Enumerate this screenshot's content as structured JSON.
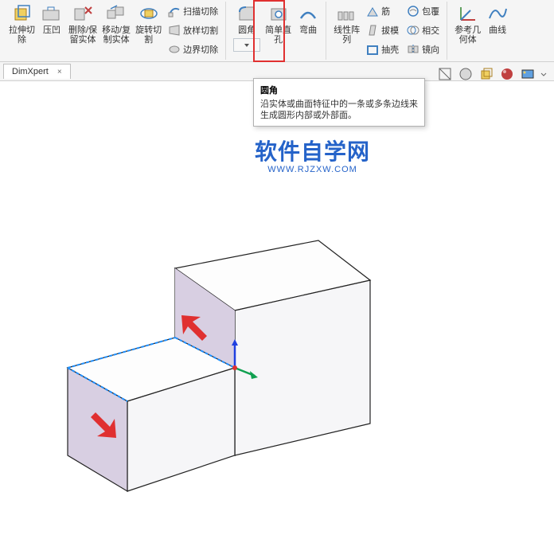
{
  "ribbon": {
    "groups": [
      {
        "large": [
          {
            "name": "extrude-cut",
            "label": "拉伸切\n除",
            "icon": "cube-cut-yellow"
          },
          {
            "name": "indent",
            "label": "压凹",
            "icon": "indent"
          },
          {
            "name": "delete-keep-body",
            "label": "删除/保\n留实体",
            "icon": "delete-body"
          },
          {
            "name": "move-copy-body",
            "label": "移动/复\n制实体",
            "icon": "move-copy"
          },
          {
            "name": "revolve-cut",
            "label": "旋转切\n割",
            "icon": "revolve-cut"
          }
        ],
        "small": [
          {
            "name": "swept-cut",
            "label": "扫描切除",
            "icon": "sweep"
          },
          {
            "name": "loft-cut",
            "label": "放样切割",
            "icon": "loft"
          },
          {
            "name": "boundary-cut",
            "label": "边界切除",
            "icon": "boundary"
          }
        ]
      },
      {
        "large": [
          {
            "name": "fillet",
            "label": "圆角",
            "icon": "fillet",
            "highlighted": true
          },
          {
            "name": "hole-wizard",
            "label": "简单直\n孔",
            "icon": "hole"
          },
          {
            "name": "bend",
            "label": "弯曲",
            "icon": "bend"
          }
        ]
      },
      {
        "large": [
          {
            "name": "linear-pattern",
            "label": "线性阵\n列",
            "icon": "linear-pattern"
          }
        ],
        "small": [
          {
            "name": "rib",
            "label": "筋",
            "icon": "rib"
          },
          {
            "name": "draft",
            "label": "拔模",
            "icon": "draft"
          },
          {
            "name": "shell",
            "label": "抽壳",
            "icon": "shell"
          }
        ],
        "small2": [
          {
            "name": "wrap",
            "label": "包覆",
            "icon": "wrap"
          },
          {
            "name": "intersect",
            "label": "相交",
            "icon": "intersect"
          },
          {
            "name": "mirror",
            "label": "镜向",
            "icon": "mirror"
          }
        ]
      },
      {
        "large": [
          {
            "name": "ref-geometry",
            "label": "参考几\n何体",
            "icon": "ref-geom"
          },
          {
            "name": "curves",
            "label": "曲线",
            "icon": "curves"
          }
        ]
      }
    ]
  },
  "tab": {
    "label": "DimXpert"
  },
  "tooltip": {
    "title": "圆角",
    "desc": "沿实体或曲面特征中的一条或多条边线来生成圆形内部或外部面。"
  },
  "watermark": {
    "cn": "软件自学网",
    "url": "WWW.RJZXW.COM"
  },
  "viewToolbar": [
    "section-view",
    "shaded-edges",
    "orientation",
    "appearances",
    "scene"
  ]
}
